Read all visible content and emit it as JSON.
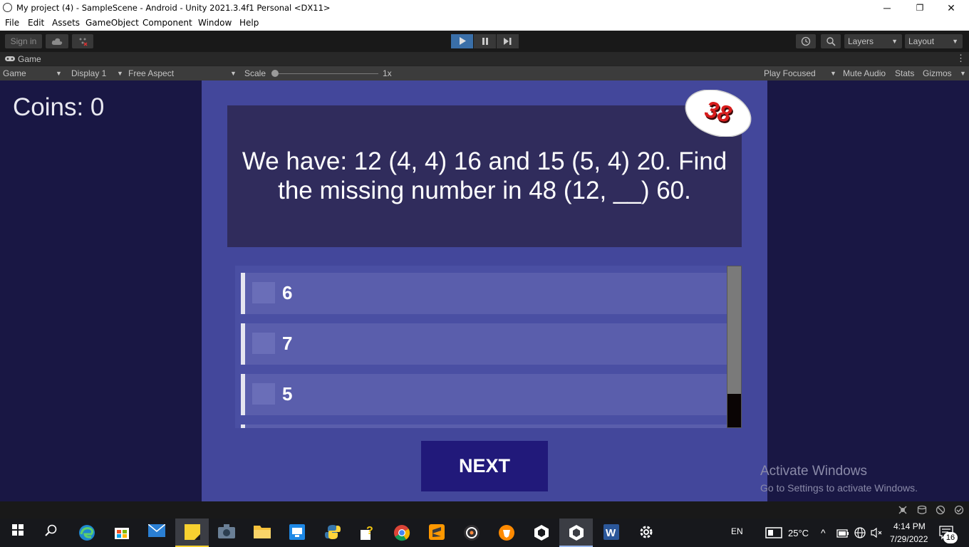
{
  "window": {
    "title": "My project (4) - SampleScene - Android - Unity 2021.3.4f1 Personal <DX11>",
    "minimize": "─",
    "maximize": "❐",
    "close": "✕"
  },
  "menu": [
    "File",
    "Edit",
    "Assets",
    "GameObject",
    "Component",
    "Window",
    "Help"
  ],
  "toolbar": {
    "sign_in": "Sign in",
    "layers": "Layers",
    "layout": "Layout"
  },
  "game_tab": {
    "label": "Game",
    "mode": "Game",
    "display": "Display 1",
    "aspect": "Free Aspect",
    "scale_label": "Scale",
    "scale_value": "1x",
    "play_focused": "Play Focused",
    "mute_audio": "Mute Audio",
    "stats": "Stats",
    "gizmos": "Gizmos"
  },
  "game": {
    "coins": "Coins: 0",
    "timer": "38",
    "question_line1": "We have: 12 (4, 4) 16 and 15 (5, 4) 20. Find",
    "question_line2": "the missing number in 48 (12, __) 60.",
    "answers": [
      "6",
      "7",
      "5"
    ],
    "next": "NEXT"
  },
  "watermark": {
    "line1": "Activate Windows",
    "line2": "Go to Settings to activate Windows."
  },
  "taskbar": {
    "language": "EN",
    "temperature": "25°C",
    "time": "4:14 PM",
    "date": "7/29/2022",
    "notifications": "16"
  },
  "colors": {
    "game_bg": "#191744",
    "panel": "#43479b",
    "question_box": "#302c5c",
    "answer_item": "#5a5eac",
    "next_button": "#21197a",
    "badge_text": "#d81c1c"
  }
}
